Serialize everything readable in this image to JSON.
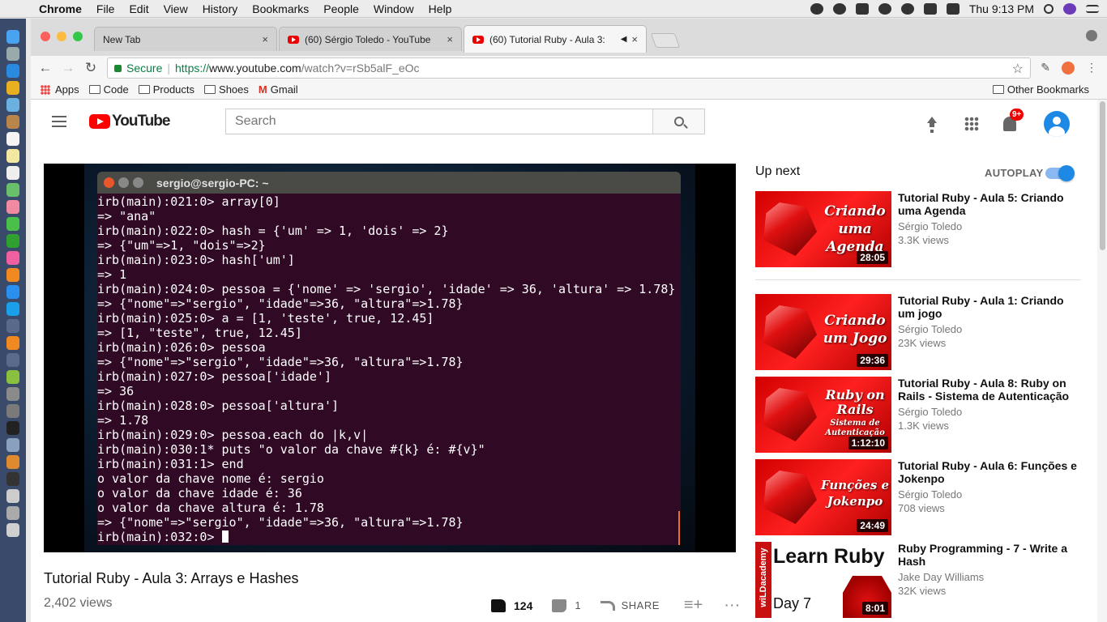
{
  "menubar": {
    "app": "Chrome",
    "items": [
      "File",
      "Edit",
      "View",
      "History",
      "Bookmarks",
      "People",
      "Window",
      "Help"
    ],
    "clock": "Thu 9:13 PM"
  },
  "tabs": [
    {
      "label": "New Tab",
      "close": "×"
    },
    {
      "label": "(60) Sérgio Toledo - YouTube",
      "close": "×"
    },
    {
      "label": "(60) Tutorial Ruby - Aula 3:",
      "close": "×"
    }
  ],
  "address": {
    "secure": "Secure",
    "proto": "https://",
    "host": "www.youtube.com",
    "path": "/watch?v=rSb5alF_eOc"
  },
  "bookmarks": {
    "items": [
      "Apps",
      "Code",
      "Products",
      "Shoes",
      "Gmail"
    ],
    "other": "Other Bookmarks"
  },
  "youtube": {
    "logo": "YouTube",
    "search_placeholder": "Search",
    "notif_badge": "9+"
  },
  "video": {
    "terminal_title": "sergio@sergio-PC: ~",
    "terminal_lines": [
      "irb(main):021:0> array[0]",
      "=> \"ana\"",
      "irb(main):022:0> hash = {'um' => 1, 'dois' => 2}",
      "=> {\"um\"=>1, \"dois\"=>2}",
      "irb(main):023:0> hash['um']",
      "=> 1",
      "irb(main):024:0> pessoa = {'nome' => 'sergio', 'idade' => 36, 'altura' => 1.78}",
      "=> {\"nome\"=>\"sergio\", \"idade\"=>36, \"altura\"=>1.78}",
      "irb(main):025:0> a = [1, 'teste', true, 12.45]",
      "=> [1, \"teste\", true, 12.45]",
      "irb(main):026:0> pessoa",
      "=> {\"nome\"=>\"sergio\", \"idade\"=>36, \"altura\"=>1.78}",
      "irb(main):027:0> pessoa['idade']",
      "=> 36",
      "irb(main):028:0> pessoa['altura']",
      "=> 1.78",
      "irb(main):029:0> pessoa.each do |k,v|",
      "irb(main):030:1* puts \"o valor da chave #{k} é: #{v}\"",
      "irb(main):031:1> end",
      "o valor da chave nome é: sergio",
      "o valor da chave idade é: 36",
      "o valor da chave altura é: 1.78",
      "=> {\"nome\"=>\"sergio\", \"idade\"=>36, \"altura\"=>1.78}"
    ],
    "terminal_prompt": "irb(main):032:0> ",
    "title": "Tutorial Ruby - Aula 3: Arrays e Hashes",
    "views": "2,402 views",
    "likes": "124",
    "dislikes": "1",
    "share": "SHARE"
  },
  "sidebar": {
    "up_next": "Up next",
    "autoplay": "AUTOPLAY",
    "recommendations": [
      {
        "thumb_text": "Criando uma Agenda",
        "duration": "28:05",
        "title": "Tutorial Ruby - Aula 5: Criando uma Agenda",
        "channel": "Sérgio Toledo",
        "views": "3.3K views"
      },
      {
        "thumb_text": "Criando um Jogo",
        "duration": "29:36",
        "title": "Tutorial Ruby - Aula 1: Criando um jogo",
        "channel": "Sérgio Toledo",
        "views": "23K views"
      },
      {
        "thumb_text": "Ruby on Rails",
        "thumb_sub": "Sistema de Autenticação",
        "duration": "1:12:10",
        "title": "Tutorial Ruby - Aula 8: Ruby on Rails - Sistema de Autenticação",
        "channel": "Sérgio Toledo",
        "views": "1.3K views"
      },
      {
        "thumb_text": "Funções e Jokenpo",
        "duration": "24:49",
        "title": "Tutorial Ruby - Aula 6: Funções e Jokenpo",
        "channel": "Sérgio Toledo",
        "views": "708 views"
      },
      {
        "thumb_text": "Learn Ruby",
        "thumb_day": "Day 7",
        "thumb_band": "wiLDacademy",
        "duration": "8:01",
        "title": "Ruby Programming - 7 - Write a Hash",
        "channel": "Jake Day Williams",
        "views": "32K views"
      }
    ]
  },
  "colors": {
    "terminal_bg": "#300a24",
    "youtube_red": "#ff0000",
    "autoplay_blue": "#1e88e5"
  }
}
